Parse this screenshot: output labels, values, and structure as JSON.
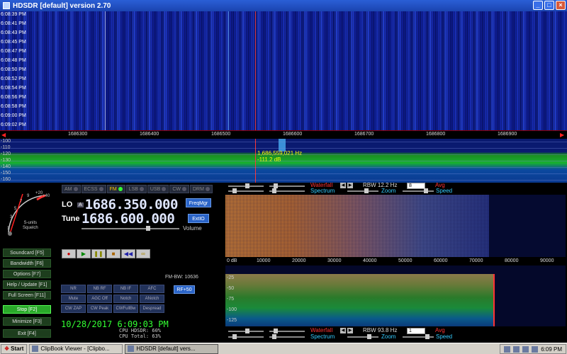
{
  "window": {
    "title": "HDSDR [default]  version 2.70"
  },
  "waterfall": {
    "times": [
      "6:08:39 PM",
      "6:08:41 PM",
      "6:08:43 PM",
      "6:08:45 PM",
      "6:08:47 PM",
      "6:08:48 PM",
      "6:08:50 PM",
      "6:08:52 PM",
      "6:08:54 PM",
      "6:08:56 PM",
      "6:08:58 PM",
      "6:09:00 PM",
      "6:09:02 PM"
    ]
  },
  "freq_scale": {
    "ticks": [
      "1686300",
      "1686400",
      "1686500",
      "1686600",
      "1686700",
      "1686800",
      "1686900"
    ]
  },
  "spectrum": {
    "db_labels": [
      "-100",
      "-110",
      "-120",
      "-130",
      "-140",
      "-150",
      "-160"
    ],
    "readout_freq": "1,686,559,021 Hz",
    "readout_db": "-111.2 dB"
  },
  "smeter": {
    "label": "S-units",
    "sub": "Squelch",
    "scale": [
      "1",
      "3",
      "5",
      "7",
      "9",
      "+20",
      "+40"
    ]
  },
  "modes": [
    {
      "label": "AM",
      "active": false
    },
    {
      "label": "ECSS",
      "active": false
    },
    {
      "label": "FM",
      "active": true
    },
    {
      "label": "LSB",
      "active": false
    },
    {
      "label": "USB",
      "active": false
    },
    {
      "label": "CW",
      "active": false
    },
    {
      "label": "DRM",
      "active": false
    }
  ],
  "lo": {
    "label": "LO",
    "badge": "A",
    "value": "1686.350.000",
    "button": "FreqMgr"
  },
  "tune": {
    "label": "Tune",
    "value": "1686.600.000",
    "button": "ExtIO"
  },
  "volume_label": "Volume",
  "side_buttons": [
    {
      "label": "Soundcard  [F5]"
    },
    {
      "label": "Bandwidth  [F6]"
    },
    {
      "label": "Options  [F7]"
    },
    {
      "label": "Help / Update  [F1]"
    },
    {
      "label": "Full Screen  [F11]"
    },
    {
      "label": "Stop  [F2]"
    },
    {
      "label": "Minimize  [F3]"
    },
    {
      "label": "Exit  [F4]"
    }
  ],
  "dsp_buttons": [
    "NR",
    "NB RF",
    "NB IF",
    "AFC",
    "Mute",
    "AGC Off",
    "Notch",
    "ANotch",
    "CW ZAP",
    "CW Peak",
    "CWFullBw",
    "Despread"
  ],
  "fm_bw": "FM-BW: 10636",
  "rf_button": "RF+50",
  "datetime": "10/28/2017 6:09:03 PM",
  "cpu": {
    "hdsdr": "CPU HDSDR:  60%",
    "total": "CPU Total:  63%"
  },
  "top_controls": {
    "waterfall": "Waterfall",
    "spectrum": "Spectrum",
    "zoom": "Zoom",
    "speed": "Speed",
    "rbw": "RBW 12.2 Hz",
    "avg": "Avg",
    "select": "8"
  },
  "audio_scale": [
    "0 dB",
    "10000",
    "20000",
    "30000",
    "40000",
    "50000",
    "60000",
    "70000",
    "80000",
    "90000"
  ],
  "audio_spec_labels": [
    "-25",
    "-50",
    "-75",
    "-100",
    "-125"
  ],
  "bottom_controls": {
    "waterfall": "Waterfall",
    "spectrum": "Spectrum",
    "zoom": "Zoom",
    "speed": "Speed",
    "rbw": "RBW 93.8 Hz",
    "avg": "Avg",
    "select": "1"
  },
  "taskbar": {
    "start": "Start",
    "tasks": [
      {
        "label": "ClipBook Viewer - [Clipbo...",
        "active": false
      },
      {
        "label": "HDSDR [default] vers...",
        "active": true
      }
    ],
    "clock": "6:09 PM"
  }
}
